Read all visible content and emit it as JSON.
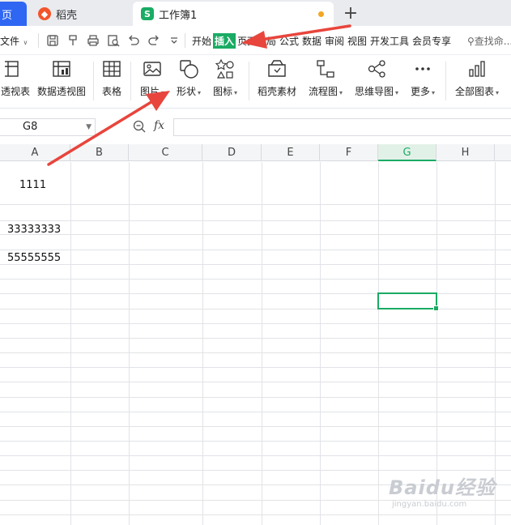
{
  "tabs": {
    "home": "页",
    "docer": "稻壳",
    "workbook": "工作簿1",
    "new_tab": "+"
  },
  "menu": {
    "file": "文件",
    "items": [
      "开始",
      "插入",
      "页面布局",
      "公式",
      "数据",
      "审阅",
      "视图",
      "开发工具",
      "会员专享"
    ],
    "search": "查找命..."
  },
  "ribbon": {
    "pivot_table": "透视表",
    "pivot_chart": "数据透视图",
    "table": "表格",
    "picture": "图片",
    "shape": "形状",
    "icon": "图标",
    "docer_material": "稻壳素材",
    "flowchart": "流程图",
    "mindmap": "思维导图",
    "more": "更多",
    "all_charts": "全部图表"
  },
  "formula_bar": {
    "name_box": "G8",
    "fx": "fx",
    "value": ""
  },
  "sheet": {
    "columns": [
      "A",
      "B",
      "C",
      "D",
      "E",
      "F",
      "G",
      "H"
    ],
    "selected_column": "G",
    "cells": {
      "A2": "1111",
      "A4": "33333333",
      "A5": "55555555"
    }
  },
  "watermark": {
    "brand": "Baidu经验",
    "url": "jingyan.baidu.com"
  },
  "colors": {
    "accent": "#1aab64",
    "home_tab": "#2f67f3",
    "arrow": "#e8453c"
  }
}
